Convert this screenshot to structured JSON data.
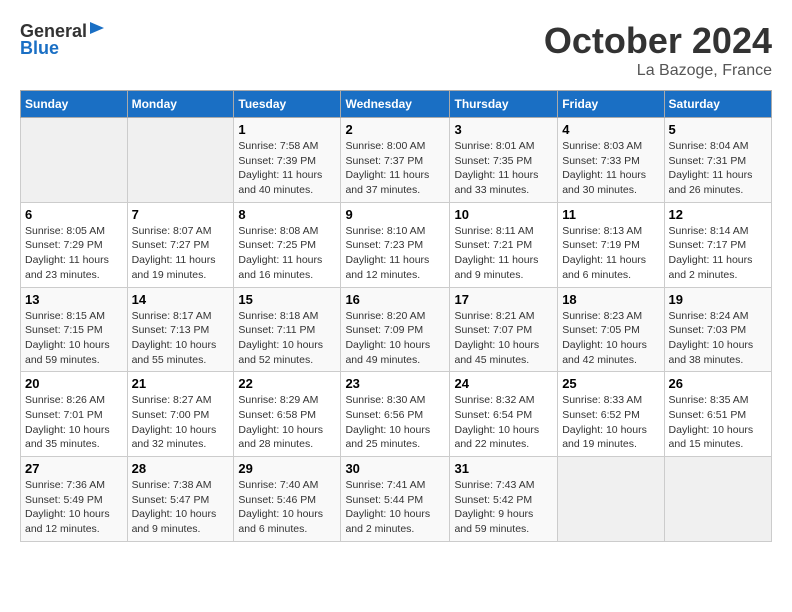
{
  "header": {
    "logo_general": "General",
    "logo_blue": "Blue",
    "month_title": "October 2024",
    "location": "La Bazoge, France"
  },
  "days_of_week": [
    "Sunday",
    "Monday",
    "Tuesday",
    "Wednesday",
    "Thursday",
    "Friday",
    "Saturday"
  ],
  "weeks": [
    [
      {
        "day": "",
        "info": ""
      },
      {
        "day": "",
        "info": ""
      },
      {
        "day": "1",
        "info": "Sunrise: 7:58 AM\nSunset: 7:39 PM\nDaylight: 11 hours and 40 minutes."
      },
      {
        "day": "2",
        "info": "Sunrise: 8:00 AM\nSunset: 7:37 PM\nDaylight: 11 hours and 37 minutes."
      },
      {
        "day": "3",
        "info": "Sunrise: 8:01 AM\nSunset: 7:35 PM\nDaylight: 11 hours and 33 minutes."
      },
      {
        "day": "4",
        "info": "Sunrise: 8:03 AM\nSunset: 7:33 PM\nDaylight: 11 hours and 30 minutes."
      },
      {
        "day": "5",
        "info": "Sunrise: 8:04 AM\nSunset: 7:31 PM\nDaylight: 11 hours and 26 minutes."
      }
    ],
    [
      {
        "day": "6",
        "info": "Sunrise: 8:05 AM\nSunset: 7:29 PM\nDaylight: 11 hours and 23 minutes."
      },
      {
        "day": "7",
        "info": "Sunrise: 8:07 AM\nSunset: 7:27 PM\nDaylight: 11 hours and 19 minutes."
      },
      {
        "day": "8",
        "info": "Sunrise: 8:08 AM\nSunset: 7:25 PM\nDaylight: 11 hours and 16 minutes."
      },
      {
        "day": "9",
        "info": "Sunrise: 8:10 AM\nSunset: 7:23 PM\nDaylight: 11 hours and 12 minutes."
      },
      {
        "day": "10",
        "info": "Sunrise: 8:11 AM\nSunset: 7:21 PM\nDaylight: 11 hours and 9 minutes."
      },
      {
        "day": "11",
        "info": "Sunrise: 8:13 AM\nSunset: 7:19 PM\nDaylight: 11 hours and 6 minutes."
      },
      {
        "day": "12",
        "info": "Sunrise: 8:14 AM\nSunset: 7:17 PM\nDaylight: 11 hours and 2 minutes."
      }
    ],
    [
      {
        "day": "13",
        "info": "Sunrise: 8:15 AM\nSunset: 7:15 PM\nDaylight: 10 hours and 59 minutes."
      },
      {
        "day": "14",
        "info": "Sunrise: 8:17 AM\nSunset: 7:13 PM\nDaylight: 10 hours and 55 minutes."
      },
      {
        "day": "15",
        "info": "Sunrise: 8:18 AM\nSunset: 7:11 PM\nDaylight: 10 hours and 52 minutes."
      },
      {
        "day": "16",
        "info": "Sunrise: 8:20 AM\nSunset: 7:09 PM\nDaylight: 10 hours and 49 minutes."
      },
      {
        "day": "17",
        "info": "Sunrise: 8:21 AM\nSunset: 7:07 PM\nDaylight: 10 hours and 45 minutes."
      },
      {
        "day": "18",
        "info": "Sunrise: 8:23 AM\nSunset: 7:05 PM\nDaylight: 10 hours and 42 minutes."
      },
      {
        "day": "19",
        "info": "Sunrise: 8:24 AM\nSunset: 7:03 PM\nDaylight: 10 hours and 38 minutes."
      }
    ],
    [
      {
        "day": "20",
        "info": "Sunrise: 8:26 AM\nSunset: 7:01 PM\nDaylight: 10 hours and 35 minutes."
      },
      {
        "day": "21",
        "info": "Sunrise: 8:27 AM\nSunset: 7:00 PM\nDaylight: 10 hours and 32 minutes."
      },
      {
        "day": "22",
        "info": "Sunrise: 8:29 AM\nSunset: 6:58 PM\nDaylight: 10 hours and 28 minutes."
      },
      {
        "day": "23",
        "info": "Sunrise: 8:30 AM\nSunset: 6:56 PM\nDaylight: 10 hours and 25 minutes."
      },
      {
        "day": "24",
        "info": "Sunrise: 8:32 AM\nSunset: 6:54 PM\nDaylight: 10 hours and 22 minutes."
      },
      {
        "day": "25",
        "info": "Sunrise: 8:33 AM\nSunset: 6:52 PM\nDaylight: 10 hours and 19 minutes."
      },
      {
        "day": "26",
        "info": "Sunrise: 8:35 AM\nSunset: 6:51 PM\nDaylight: 10 hours and 15 minutes."
      }
    ],
    [
      {
        "day": "27",
        "info": "Sunrise: 7:36 AM\nSunset: 5:49 PM\nDaylight: 10 hours and 12 minutes."
      },
      {
        "day": "28",
        "info": "Sunrise: 7:38 AM\nSunset: 5:47 PM\nDaylight: 10 hours and 9 minutes."
      },
      {
        "day": "29",
        "info": "Sunrise: 7:40 AM\nSunset: 5:46 PM\nDaylight: 10 hours and 6 minutes."
      },
      {
        "day": "30",
        "info": "Sunrise: 7:41 AM\nSunset: 5:44 PM\nDaylight: 10 hours and 2 minutes."
      },
      {
        "day": "31",
        "info": "Sunrise: 7:43 AM\nSunset: 5:42 PM\nDaylight: 9 hours and 59 minutes."
      },
      {
        "day": "",
        "info": ""
      },
      {
        "day": "",
        "info": ""
      }
    ]
  ]
}
